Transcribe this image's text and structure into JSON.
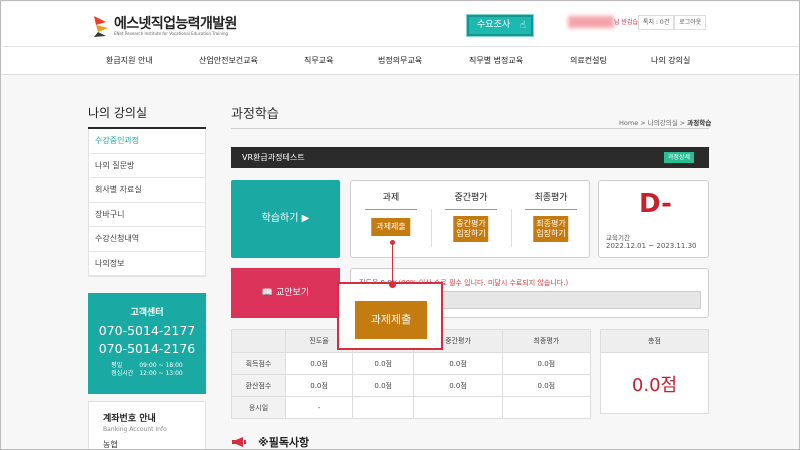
{
  "header": {
    "logo_name": "에스넷직업능력개발원",
    "logo_sub": "ENet Research Institute for Vocational Education Training",
    "survey_label": "수요조사",
    "welcome": "님 반갑습니다!",
    "mini_links": [
      "톡지 : 0건",
      "로그아웃"
    ]
  },
  "gnb": [
    "환급지원 안내",
    "산업안전보건교육",
    "직무교육",
    "법정의무교육",
    "직무별 법정교육",
    "의료컨설팅",
    "나의 강의실"
  ],
  "sidebar": {
    "title": "나의 강의실",
    "items": [
      {
        "label": "수강중인과정",
        "active": true
      },
      {
        "label": "나의 질문방",
        "active": false
      },
      {
        "label": "회사별 자료실",
        "active": false
      },
      {
        "label": "장바구니",
        "active": false
      },
      {
        "label": "수강신청내역",
        "active": false
      },
      {
        "label": "나의정보",
        "active": false
      }
    ],
    "customer_center": {
      "title": "고객센터",
      "phones": [
        "070-5014-2177",
        "070-5014-2176"
      ],
      "hours_labels": [
        "평일",
        "점심시간"
      ],
      "hours_values": [
        "09:00 ~ 18:00",
        "12:00 ~ 13:00"
      ]
    },
    "bank": {
      "title": "계좌번호 안내",
      "subtitle": "Banking Account Info",
      "bank_name": "농협"
    }
  },
  "main": {
    "page_title": "과정학습",
    "breadcrumb": [
      "Home",
      "나의강의실",
      "과정학습"
    ],
    "course_name": "VR환급과정테스트",
    "detail_badge": "과정상세",
    "study_button": "학습하기",
    "tasks": {
      "task_label": "과제",
      "task_button": "과제제출",
      "midterm_label": "중간평가",
      "midterm_button": [
        "중간평가",
        "입장하기"
      ],
      "final_label": "최종평가",
      "final_button": [
        "최종평가",
        "입장하기"
      ]
    },
    "grade": "D-",
    "period_label": "교육기간",
    "period": "2022.12.01 ~ 2023.11.30",
    "textbook_button": "교안보기",
    "progress_msg_prefix": "진도율 0.0%",
    "progress_msg_warn": "(80% 이상 수료 필수 입니다. 미달시 수료되지 않습니다.)",
    "progress": 0.0,
    "score_table": {
      "headers": [
        "",
        "진도율",
        "과제",
        "중간평가",
        "최종평가"
      ],
      "rows": [
        {
          "label": "획득점수",
          "values": [
            "0.0점",
            "0.0점",
            "0.0점",
            "0.0점"
          ]
        },
        {
          "label": "환산점수",
          "values": [
            "0.0점",
            "0.0점",
            "0.0점",
            "0.0점"
          ]
        },
        {
          "label": "응시일",
          "values": [
            "-",
            "",
            "",
            ""
          ]
        }
      ]
    },
    "total_label": "총점",
    "total_value": "0.0점",
    "notice_title": "※필독사항",
    "zoom_button": "과제제출"
  },
  "colors": {
    "teal": "#1ba9a3",
    "pink": "#db3359",
    "amber": "#c47b0f",
    "red": "#c8202e"
  }
}
